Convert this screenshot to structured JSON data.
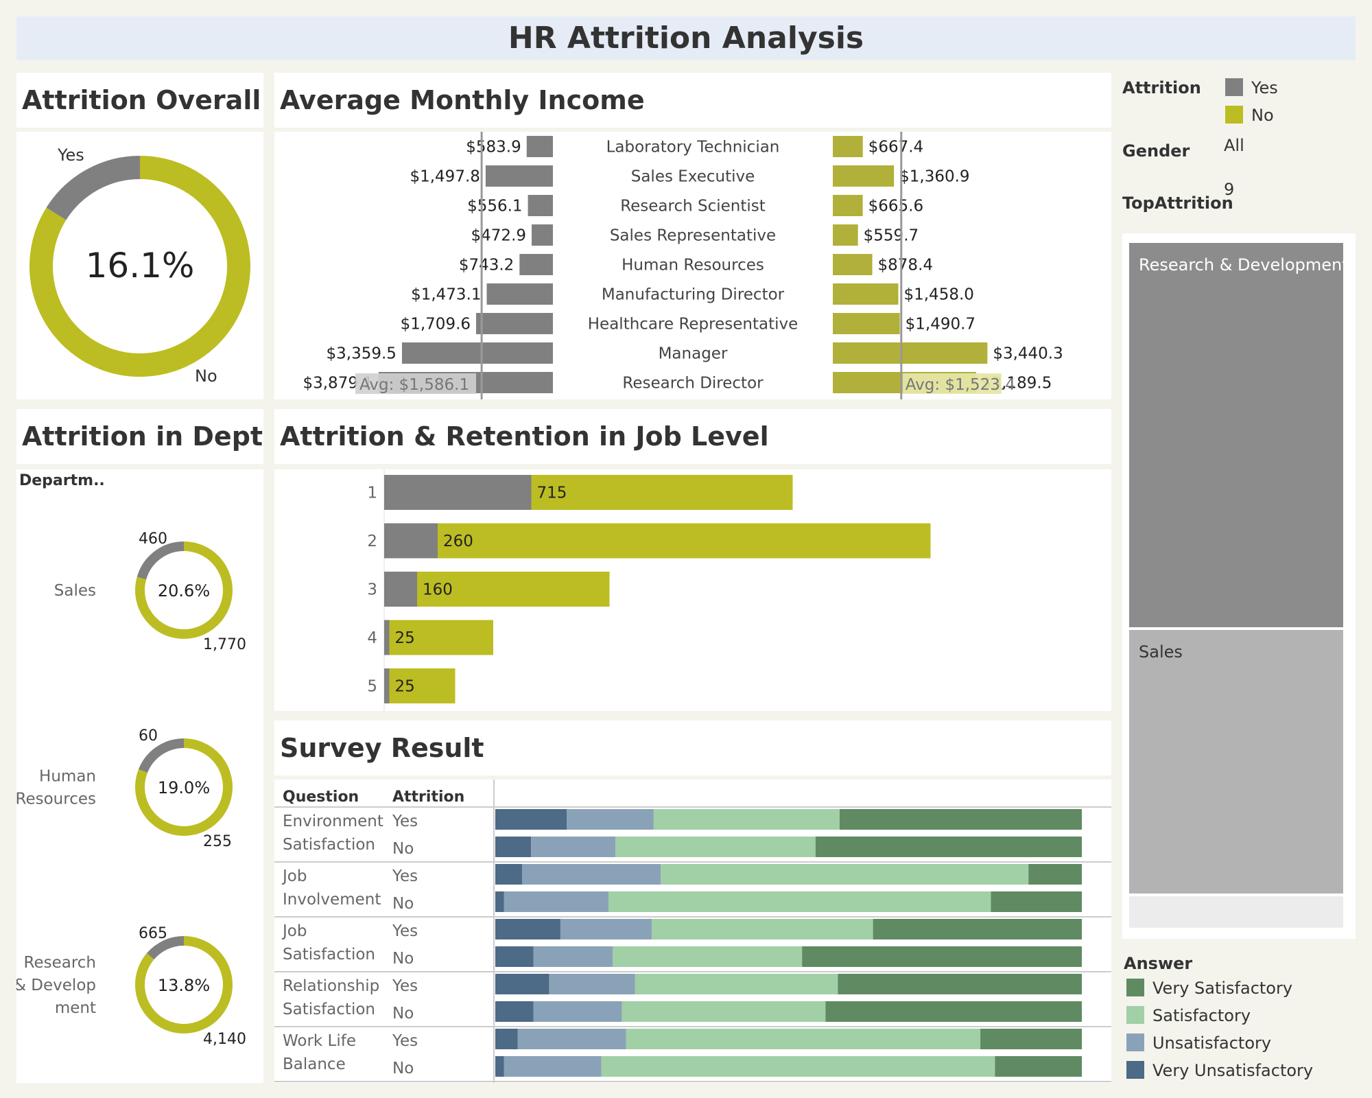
{
  "dashboard_title": "HR Attrition Analysis",
  "colors": {
    "yes": "#808080",
    "no": "#bcbd22",
    "no_income": "#b0b03a",
    "very_satisfactory": "#5f8a62",
    "satisfactory": "#a1cfa6",
    "unsatisfactory": "#8aa2b8",
    "very_unsatisfactory": "#4d6a86"
  },
  "panels": {
    "attrition_overall": "Attrition Overall",
    "avg_monthly_income": "Average Monthly Income",
    "attrition_dept": "Attrition in Dept",
    "job_level": "Attrition & Retention in Job Level",
    "survey": "Survey Result"
  },
  "filters": {
    "attrition_label": "Attrition",
    "legend_yes": "Yes",
    "legend_no": "No",
    "gender_label": "Gender",
    "gender_value": "All",
    "top_label": "TopAttrition",
    "top_value": "9"
  },
  "overall": {
    "yes_label": "Yes",
    "no_label": "No",
    "pct_text": "16.1%",
    "yes_share": 0.161
  },
  "dept": {
    "header": "Departm..",
    "items": [
      {
        "name_lines": [
          "Sales"
        ],
        "yes_value": "460",
        "no_value": "1,770",
        "pct_text": "20.6%",
        "yes_share": 0.206
      },
      {
        "name_lines": [
          "Human",
          "Resources"
        ],
        "yes_value": "60",
        "no_value": "255",
        "pct_text": "19.0%",
        "yes_share": 0.19
      },
      {
        "name_lines": [
          "Research",
          "& Develop",
          "ment"
        ],
        "yes_value": "665",
        "no_value": "4,140",
        "pct_text": "13.8%",
        "yes_share": 0.138
      }
    ]
  },
  "treemap": {
    "tiles": [
      {
        "label": "Research & Development"
      },
      {
        "label": "Sales"
      }
    ]
  },
  "answer_legend": {
    "title": "Answer",
    "items": [
      {
        "label": "Very Satisfactory",
        "key": "very_satisfactory"
      },
      {
        "label": "Satisfactory",
        "key": "satisfactory"
      },
      {
        "label": "Unsatisfactory",
        "key": "unsatisfactory"
      },
      {
        "label": "Very Unsatisfactory",
        "key": "very_unsatisfactory"
      }
    ]
  },
  "chart_data": [
    {
      "type": "bar",
      "name": "Average Monthly Income",
      "categories": [
        "Laboratory Technician",
        "Sales Executive",
        "Research Scientist",
        "Sales Representative",
        "Human Resources",
        "Manufacturing Director",
        "Healthcare Representative",
        "Manager",
        "Research Director"
      ],
      "series": [
        {
          "name": "Yes",
          "values": [
            583.9,
            1497.8,
            556.1,
            472.9,
            743.2,
            1473.1,
            1709.6,
            3359.5,
            3879.1
          ],
          "labels": [
            "$583.9",
            "$1,497.8",
            "$556.1",
            "$472.9",
            "$743.2",
            "$1,473.1",
            "$1,709.6",
            "$3,359.5",
            "$3,879.1"
          ]
        },
        {
          "name": "No",
          "values": [
            667.4,
            1360.9,
            665.6,
            559.7,
            878.4,
            1458.0,
            1490.7,
            3440.3,
            3189.5
          ],
          "labels": [
            "$667.4",
            "$1,360.9",
            "$665.6",
            "$559.7",
            "$878.4",
            "$1,458.0",
            "$1,490.7",
            "$3,440.3",
            "$3,189.5"
          ]
        }
      ],
      "reference_lines": [
        {
          "series": "Yes",
          "value": 1586.1,
          "label": "Avg: $1,586.1"
        },
        {
          "series": "No",
          "value": 1523.4,
          "label": "Avg: $1,523.4"
        }
      ]
    },
    {
      "type": "bar",
      "name": "Attrition & Retention in Job Level",
      "categories": [
        "1",
        "2",
        "3",
        "4",
        "5"
      ],
      "series": [
        {
          "name": "Yes",
          "values": [
            715,
            260,
            160,
            25,
            25
          ],
          "labels": [
            "715",
            "260",
            "160",
            "25",
            "25"
          ]
        },
        {
          "name": "No",
          "values": [
            1270,
            2395,
            935,
            505,
            320
          ]
        }
      ]
    },
    {
      "type": "bar",
      "name": "Survey Result",
      "stacked": "percent",
      "headers": {
        "question": "Question",
        "attrition": "Attrition"
      },
      "segments": [
        "very_unsatisfactory",
        "unsatisfactory",
        "satisfactory",
        "very_satisfactory"
      ],
      "questions": [
        {
          "lines": [
            "Environment",
            "Satisfaction"
          ],
          "rows": [
            {
              "attrition": "Yes",
              "values": [
                12.2,
                14.8,
                31.7,
                41.3
              ]
            },
            {
              "attrition": "No",
              "values": [
                6.1,
                14.4,
                34.1,
                45.4
              ]
            }
          ]
        },
        {
          "lines": [
            "Job",
            "Involvement"
          ],
          "rows": [
            {
              "attrition": "Yes",
              "values": [
                4.6,
                23.6,
                62.7,
                9.1
              ]
            },
            {
              "attrition": "No",
              "values": [
                1.5,
                17.8,
                65.2,
                15.5
              ]
            }
          ]
        },
        {
          "lines": [
            "Job",
            "Satisfaction"
          ],
          "rows": [
            {
              "attrition": "Yes",
              "values": [
                11.1,
                15.6,
                37.7,
                35.6
              ]
            },
            {
              "attrition": "No",
              "values": [
                6.5,
                13.5,
                32.3,
                47.7
              ]
            }
          ]
        },
        {
          "lines": [
            "Relationship",
            "Satisfaction"
          ],
          "rows": [
            {
              "attrition": "Yes",
              "values": [
                9.2,
                14.6,
                34.6,
                41.6
              ]
            },
            {
              "attrition": "No",
              "values": [
                6.5,
                15.1,
                34.7,
                43.7
              ]
            }
          ]
        },
        {
          "lines": [
            "Work Life",
            "Balance"
          ],
          "rows": [
            {
              "attrition": "Yes",
              "values": [
                3.8,
                18.5,
                60.4,
                17.3
              ]
            },
            {
              "attrition": "No",
              "values": [
                1.5,
                16.6,
                67.1,
                14.8
              ]
            }
          ]
        }
      ]
    }
  ]
}
